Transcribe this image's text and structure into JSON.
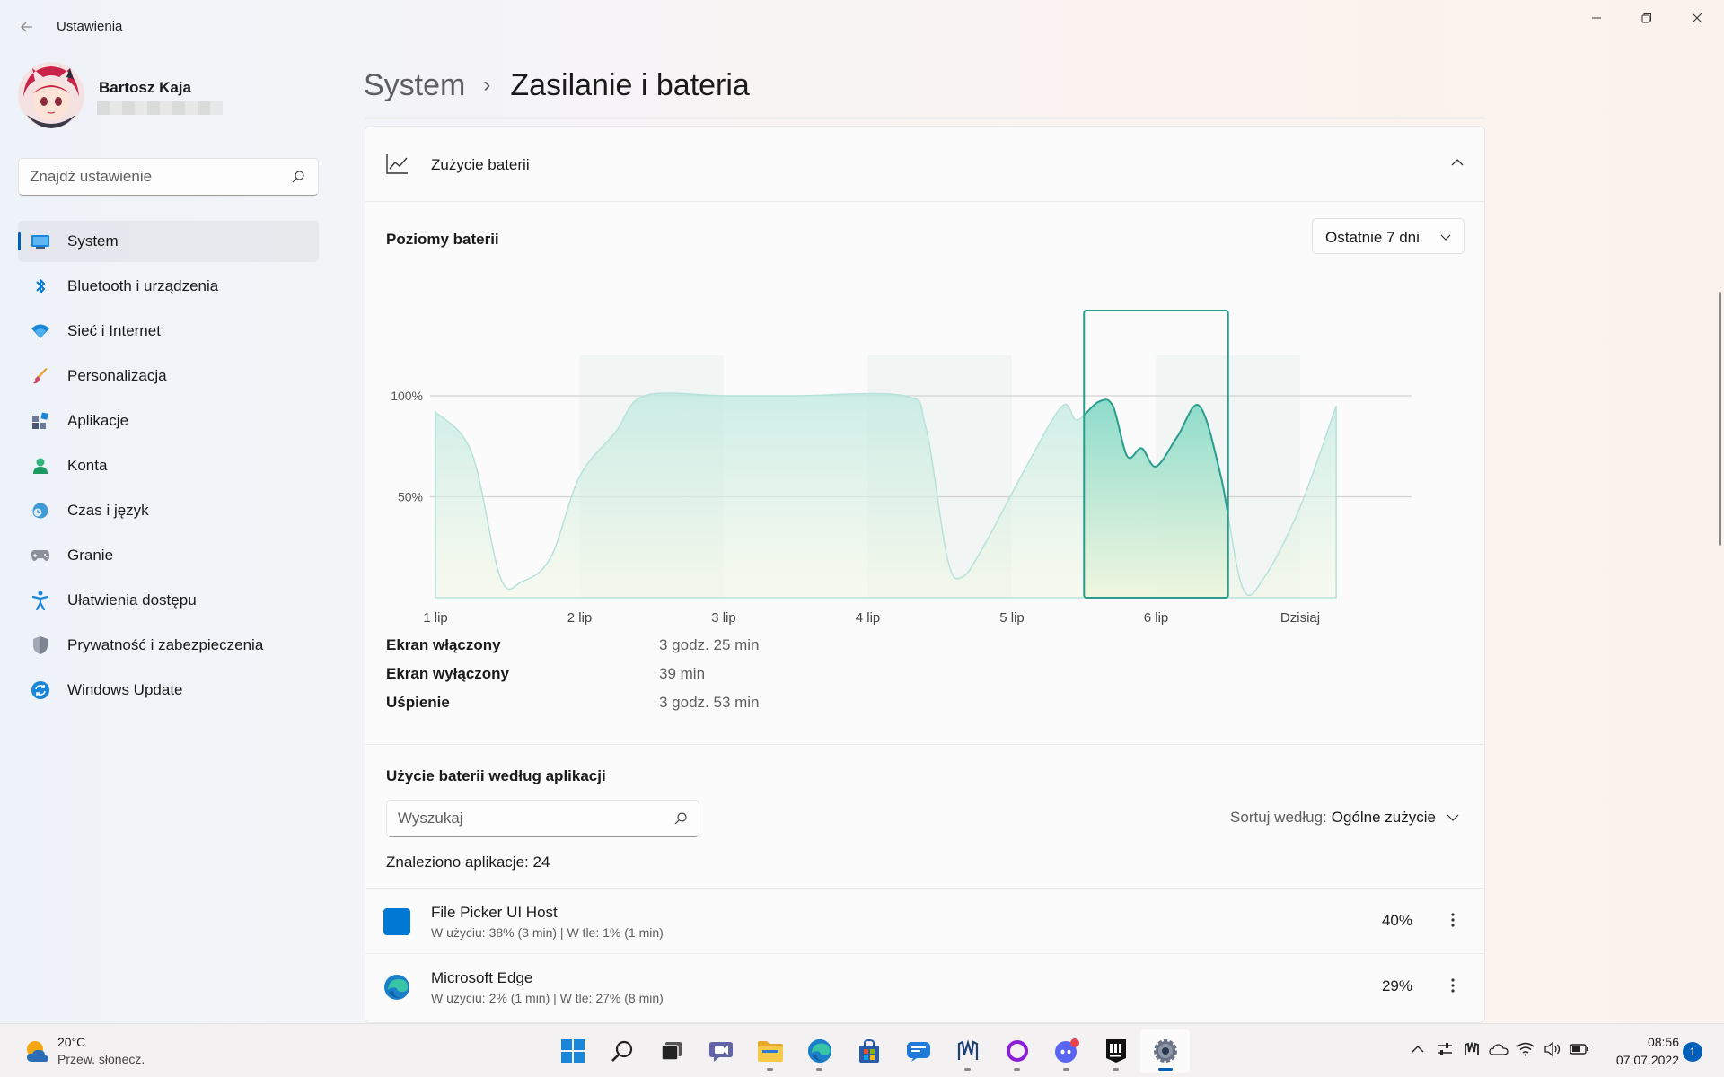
{
  "window": {
    "title": "Ustawienia"
  },
  "profile": {
    "name": "Bartosz Kaja"
  },
  "search": {
    "placeholder": "Znajdź ustawienie"
  },
  "sidebar": {
    "items": [
      {
        "label": "System",
        "icon": "system-icon",
        "active": true
      },
      {
        "label": "Bluetooth i urządzenia",
        "icon": "bluetooth-icon"
      },
      {
        "label": "Sieć i Internet",
        "icon": "wifi-icon"
      },
      {
        "label": "Personalizacja",
        "icon": "brush-icon"
      },
      {
        "label": "Aplikacje",
        "icon": "apps-icon"
      },
      {
        "label": "Konta",
        "icon": "person-icon"
      },
      {
        "label": "Czas i język",
        "icon": "clock-globe-icon"
      },
      {
        "label": "Granie",
        "icon": "gamepad-icon"
      },
      {
        "label": "Ułatwienia dostępu",
        "icon": "accessibility-icon"
      },
      {
        "label": "Prywatność i zabezpieczenia",
        "icon": "shield-icon"
      },
      {
        "label": "Windows Update",
        "icon": "update-icon"
      }
    ]
  },
  "breadcrumb": {
    "parent": "System",
    "separator": "›",
    "current": "Zasilanie i bateria"
  },
  "usage_card": {
    "title": "Zużycie baterii",
    "levels_title": "Poziomy baterii",
    "range": "Ostatnie 7 dni"
  },
  "chart_data": {
    "type": "area",
    "x": [
      "1 lip",
      "2 lip",
      "3 lip",
      "4 lip",
      "5 lip",
      "6 lip",
      "Dzisiaj"
    ],
    "yticks": [
      "100%",
      "50%"
    ],
    "ylim": [
      0,
      120
    ],
    "selected_category": "6 lip",
    "series": [
      {
        "points": [
          [
            0.0,
            92
          ],
          [
            0.25,
            72
          ],
          [
            0.45,
            10
          ],
          [
            0.6,
            8
          ],
          [
            0.8,
            20
          ],
          [
            1.0,
            60
          ],
          [
            1.25,
            82
          ],
          [
            1.45,
            100
          ],
          [
            2.0,
            100
          ],
          [
            2.5,
            100
          ],
          [
            3.25,
            100
          ],
          [
            3.4,
            85
          ],
          [
            3.55,
            20
          ],
          [
            3.65,
            10
          ],
          [
            3.8,
            25
          ],
          [
            4.1,
            65
          ],
          [
            4.35,
            95
          ],
          [
            4.45,
            88
          ],
          [
            4.6,
            97
          ],
          [
            4.7,
            95
          ],
          [
            4.8,
            70
          ],
          [
            4.9,
            74
          ],
          [
            5.0,
            65
          ],
          [
            5.15,
            80
          ],
          [
            5.3,
            95
          ],
          [
            5.45,
            60
          ],
          [
            5.6,
            5
          ],
          [
            5.75,
            10
          ],
          [
            6.0,
            45
          ],
          [
            6.25,
            95
          ]
        ],
        "color": "#2a9d8f"
      }
    ],
    "day_labels": [
      "1 lip",
      "2 lip",
      "3 lip",
      "4 lip",
      "5 lip",
      "6 lip",
      "Dzisiaj"
    ]
  },
  "stats": [
    {
      "label": "Ekran włączony",
      "value": "3 godz. 25 min"
    },
    {
      "label": "Ekran wyłączony",
      "value": "39 min"
    },
    {
      "label": "Uśpienie",
      "value": "3 godz. 53 min"
    }
  ],
  "apps_section": {
    "title": "Użycie baterii według aplikacji",
    "search_placeholder": "Wyszukaj",
    "sort_label": "Sortuj według:",
    "sort_value": "Ogólne zużycie",
    "found": "Znaleziono aplikacje: 24",
    "apps": [
      {
        "name": "File Picker UI Host",
        "detail": "W użyciu: 38% (3 min) | W tle: 1% (1 min)",
        "percent": "40%",
        "icon_color": "#0078d4"
      },
      {
        "name": "Microsoft Edge",
        "detail": "W użyciu: 2% (1 min) | W tle: 27% (8 min)",
        "percent": "29%",
        "icon_color": "#1aa3a0"
      }
    ]
  },
  "taskbar": {
    "weather_temp": "20°C",
    "weather_desc": "Przew. słonecz.",
    "time": "08:56",
    "date": "07.07.2022",
    "notifications": "1",
    "apps": [
      "start-icon",
      "search-icon",
      "task-view-icon",
      "chat-icon",
      "file-explorer-icon",
      "edge-icon",
      "store-icon",
      "mail-icon",
      "maps-icon",
      "circle-app-icon",
      "discord-icon",
      "epic-games-icon",
      "settings-icon"
    ]
  }
}
